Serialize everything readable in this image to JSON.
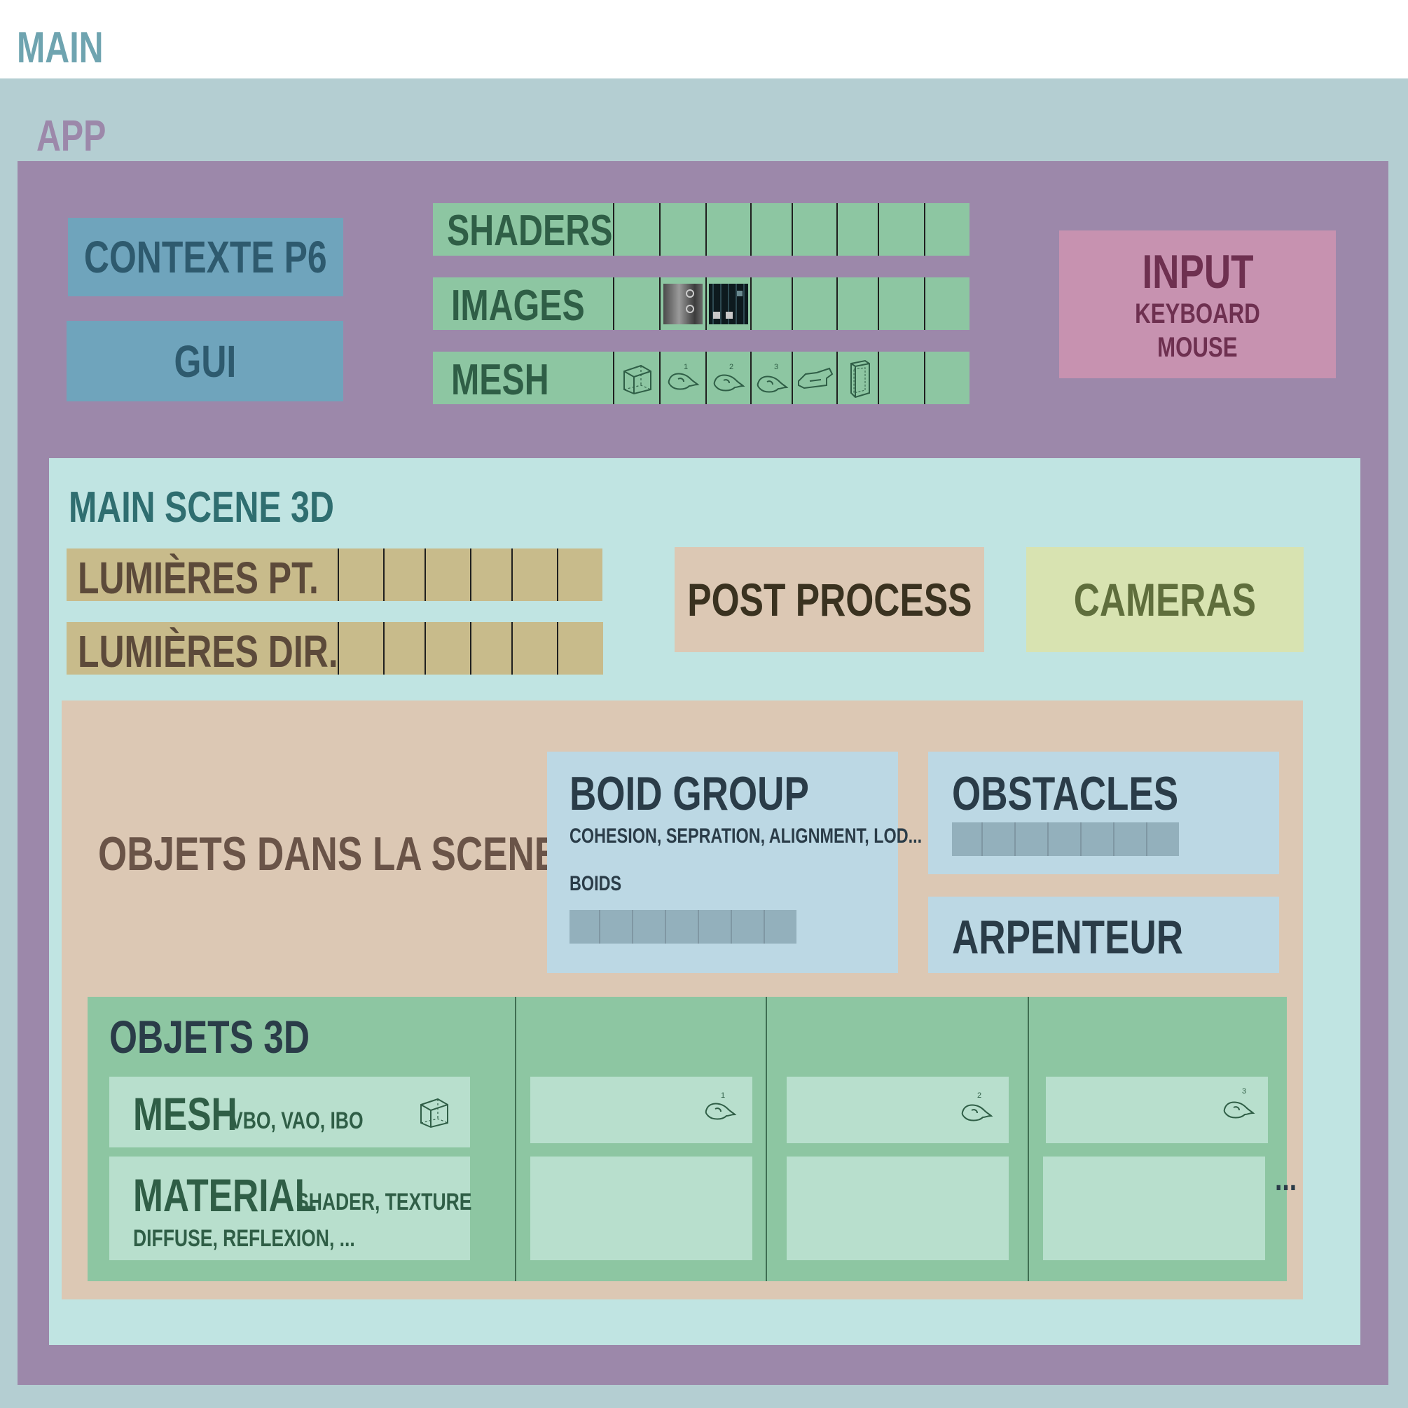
{
  "main": {
    "title": "MAIN"
  },
  "app": {
    "title": "APP"
  },
  "contexte": {
    "label": "CONTEXTE P6"
  },
  "gui": {
    "label": "GUI"
  },
  "resources": {
    "shaders": {
      "label": "SHADERS",
      "cell_count": 8
    },
    "images": {
      "label": "IMAGES",
      "cell_count": 8
    },
    "mesh": {
      "label": "MESH",
      "cell_count": 8,
      "numbers": [
        "1",
        "2",
        "3"
      ]
    }
  },
  "input": {
    "title": "INPUT",
    "line1": "KEYBOARD",
    "line2": "MOUSE"
  },
  "scene": {
    "title": "MAIN SCENE 3D",
    "lights_point": {
      "label": "LUMIÈRES PT.",
      "cell_count": 6
    },
    "lights_dir": {
      "label": "LUMIÈRES DIR.",
      "cell_count": 6
    },
    "post_process": {
      "label": "POST PROCESS"
    },
    "cameras": {
      "label": "CAMERAS"
    }
  },
  "objects": {
    "title": "OBJETS DANS LA SCENE",
    "boid_group": {
      "title": "BOID GROUP",
      "subtitle": "COHESION, SEPRATION, ALIGNMENT, LOD...",
      "boids_label": "BOIDS",
      "cell_count": 7
    },
    "obstacles": {
      "title": "OBSTACLES",
      "cell_count": 7
    },
    "arpenteur": {
      "title": "ARPENTEUR"
    }
  },
  "objets3d": {
    "title": "OBJETS 3D",
    "mesh_label": "MESH",
    "mesh_detail": "VBO, VAO, IBO",
    "material_label": "MATERIAL",
    "material_detail": "SHADER, TEXTURE",
    "material_detail2": "DIFFUSE, REFLEXION, ...",
    "mesh_numbers": [
      "1",
      "2",
      "3"
    ],
    "ellipsis": "..."
  },
  "colors": {
    "main_bg": "#b4ced2",
    "app_bg": "#9c88aa",
    "blue_box": "#6fa4bc",
    "green_res": "#8dc6a2",
    "input_box": "#c792b0",
    "scene_bg": "#c0e4e2",
    "lights": "#c8bb8b",
    "peach": "#dcc8b4",
    "cameras": "#d8e3b1",
    "light_blue": "#bcd8e4",
    "green_obj": "#8dc6a2",
    "pale_green": "#b8dfcd"
  }
}
